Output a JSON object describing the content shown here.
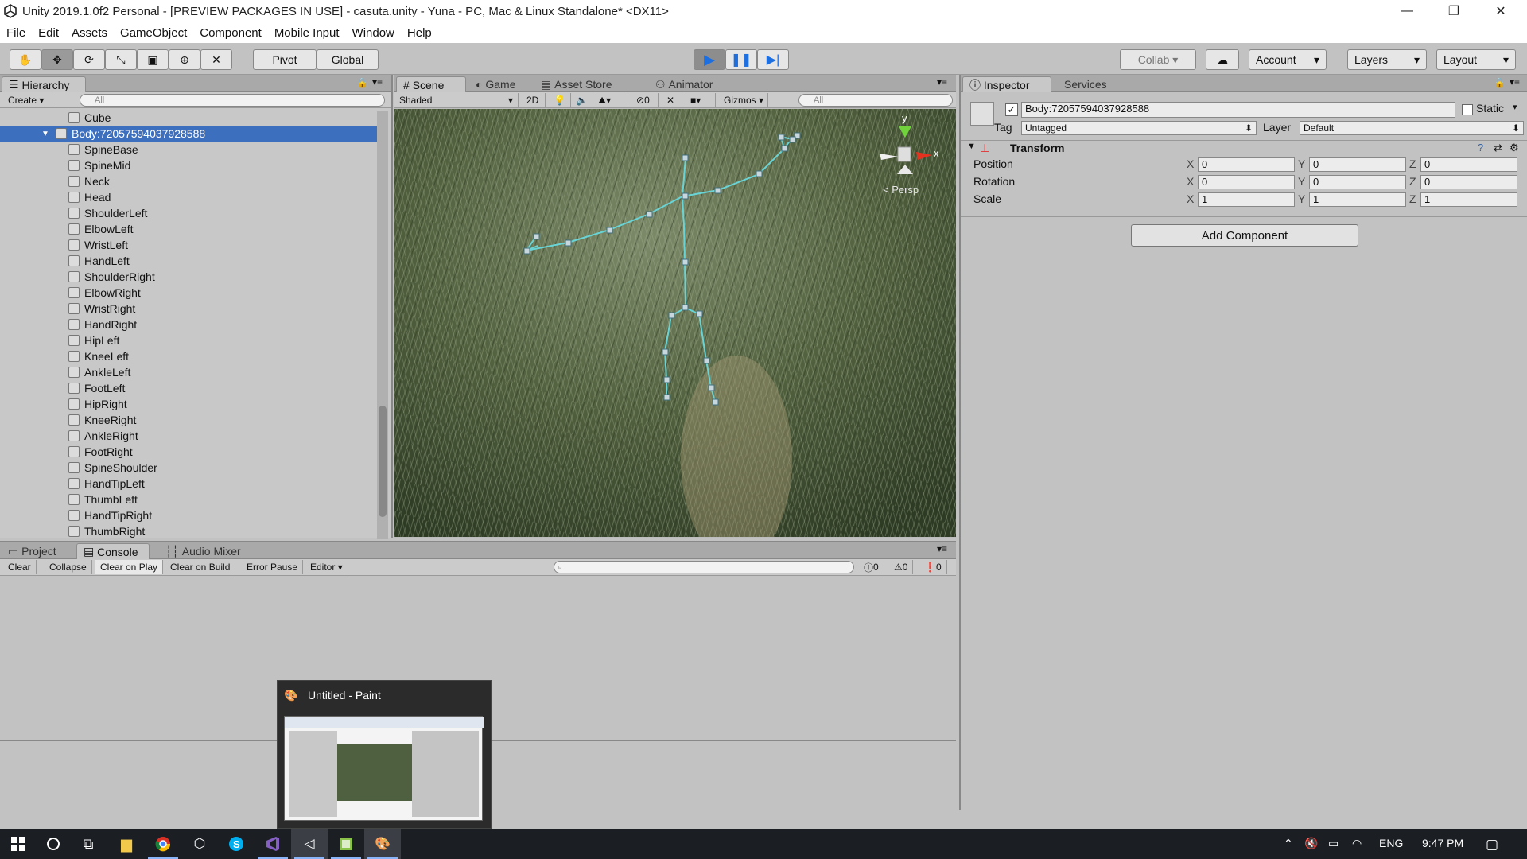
{
  "window": {
    "title": "Unity 2019.1.0f2 Personal - [PREVIEW PACKAGES IN USE] - casuta.unity - Yuna - PC, Mac & Linux Standalone* <DX11>",
    "controls": [
      "—",
      "❐",
      "✕"
    ]
  },
  "menu": [
    "File",
    "Edit",
    "Assets",
    "GameObject",
    "Component",
    "Mobile Input",
    "Window",
    "Help"
  ],
  "toolbar": {
    "pivot": "Pivot",
    "global": "Global",
    "collab": "Collab",
    "account": "Account",
    "layers": "Layers",
    "layout": "Layout"
  },
  "hierarchy": {
    "tab": "Hierarchy",
    "create": "Create",
    "search_placeholder": "All",
    "items": [
      {
        "label": "Cube",
        "indent": 1,
        "selected": false
      },
      {
        "label": "Body:72057594037928588",
        "indent": 0,
        "selected": true
      },
      {
        "label": "SpineBase",
        "indent": 1,
        "selected": false
      },
      {
        "label": "SpineMid",
        "indent": 1,
        "selected": false
      },
      {
        "label": "Neck",
        "indent": 1,
        "selected": false
      },
      {
        "label": "Head",
        "indent": 1,
        "selected": false
      },
      {
        "label": "ShoulderLeft",
        "indent": 1,
        "selected": false
      },
      {
        "label": "ElbowLeft",
        "indent": 1,
        "selected": false
      },
      {
        "label": "WristLeft",
        "indent": 1,
        "selected": false
      },
      {
        "label": "HandLeft",
        "indent": 1,
        "selected": false
      },
      {
        "label": "ShoulderRight",
        "indent": 1,
        "selected": false
      },
      {
        "label": "ElbowRight",
        "indent": 1,
        "selected": false
      },
      {
        "label": "WristRight",
        "indent": 1,
        "selected": false
      },
      {
        "label": "HandRight",
        "indent": 1,
        "selected": false
      },
      {
        "label": "HipLeft",
        "indent": 1,
        "selected": false
      },
      {
        "label": "KneeLeft",
        "indent": 1,
        "selected": false
      },
      {
        "label": "AnkleLeft",
        "indent": 1,
        "selected": false
      },
      {
        "label": "FootLeft",
        "indent": 1,
        "selected": false
      },
      {
        "label": "HipRight",
        "indent": 1,
        "selected": false
      },
      {
        "label": "KneeRight",
        "indent": 1,
        "selected": false
      },
      {
        "label": "AnkleRight",
        "indent": 1,
        "selected": false
      },
      {
        "label": "FootRight",
        "indent": 1,
        "selected": false
      },
      {
        "label": "SpineShoulder",
        "indent": 1,
        "selected": false
      },
      {
        "label": "HandTipLeft",
        "indent": 1,
        "selected": false
      },
      {
        "label": "ThumbLeft",
        "indent": 1,
        "selected": false
      },
      {
        "label": "HandTipRight",
        "indent": 1,
        "selected": false
      },
      {
        "label": "ThumbRight",
        "indent": 1,
        "selected": false
      }
    ]
  },
  "scene": {
    "tabs": [
      "Scene",
      "Game",
      "Asset Store",
      "Animator"
    ],
    "shading": "Shaded",
    "mode_2d": "2D",
    "hidden_count": "0",
    "gizmos": "Gizmos",
    "search_placeholder": "All",
    "persp": "< Persp",
    "axis_y": "y",
    "axis_x": "x"
  },
  "inspector": {
    "tabs": [
      "Inspector",
      "Services"
    ],
    "object_name": "Body:72057594037928588",
    "static_label": "Static",
    "tag_label": "Tag",
    "tag_value": "Untagged",
    "layer_label": "Layer",
    "layer_value": "Default",
    "component": "Transform",
    "rows": [
      {
        "label": "Position",
        "x": "0",
        "y": "0",
        "z": "0"
      },
      {
        "label": "Rotation",
        "x": "0",
        "y": "0",
        "z": "0"
      },
      {
        "label": "Scale",
        "x": "1",
        "y": "1",
        "z": "1"
      }
    ],
    "axis_labels": [
      "X",
      "Y",
      "Z"
    ],
    "add_component": "Add Component"
  },
  "bottom": {
    "tabs": [
      "Project",
      "Console",
      "Audio Mixer"
    ],
    "buttons": [
      "Clear",
      "Collapse",
      "Clear on Play",
      "Clear on Build",
      "Error Pause",
      "Editor"
    ],
    "counts": [
      "0",
      "0",
      "0"
    ]
  },
  "popup": {
    "title": "Untitled - Paint"
  },
  "taskbar": {
    "lang": "ENG",
    "time": "9:47 PM"
  }
}
